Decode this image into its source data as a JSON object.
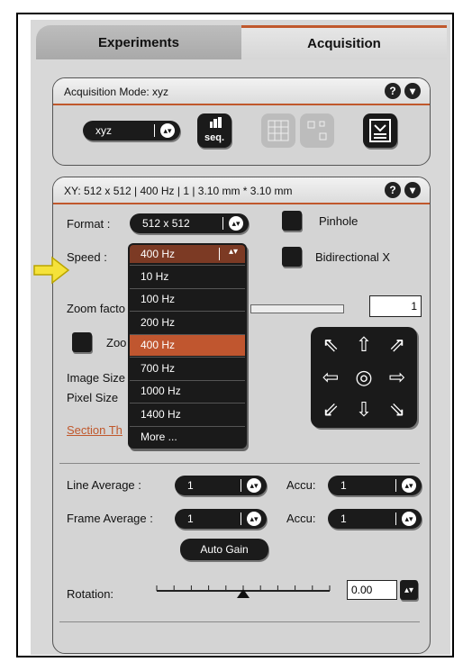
{
  "tabs": {
    "experiments": "Experiments",
    "acquisition": "Acquisition"
  },
  "acq_mode": {
    "title": "Acquisition Mode: xyz",
    "mode_value": "xyz",
    "seq_label": "seq."
  },
  "xy": {
    "title": "XY:  512 x 512 | 400 Hz | 1 | 3.10 mm * 3.10 mm",
    "format_label": "Format :",
    "format_value": "512 x 512",
    "pinhole_label": "Pinhole",
    "speed_label": "Speed :",
    "speed_value": "400 Hz",
    "bidirectional_label": "Bidirectional X",
    "zoom_label": "Zoom facto",
    "zoom_value": "1",
    "zoom_check_label": "Zoo",
    "image_size_label": "Image Size",
    "pixel_size_label": "Pixel Size",
    "section_label": "Section Th",
    "line_avg_label": "Line Average :",
    "line_avg_value": "1",
    "accu1_label": "Accu:",
    "accu1_value": "1",
    "frame_avg_label": "Frame Average :",
    "frame_avg_value": "1",
    "accu2_label": "Accu:",
    "accu2_value": "1",
    "auto_gain_label": "Auto Gain",
    "rotation_label": "Rotation:",
    "rotation_value": "0.00",
    "rotation_fraction": 0.5
  },
  "speed_options": [
    "10 Hz",
    "100 Hz",
    "200 Hz",
    "400 Hz",
    "700 Hz",
    "1000 Hz",
    "1400 Hz",
    "More ..."
  ],
  "speed_selected": "400 Hz",
  "colors": {
    "accent": "#c0582c",
    "selected": "#c0562f",
    "pointer": "#f5e23a"
  }
}
